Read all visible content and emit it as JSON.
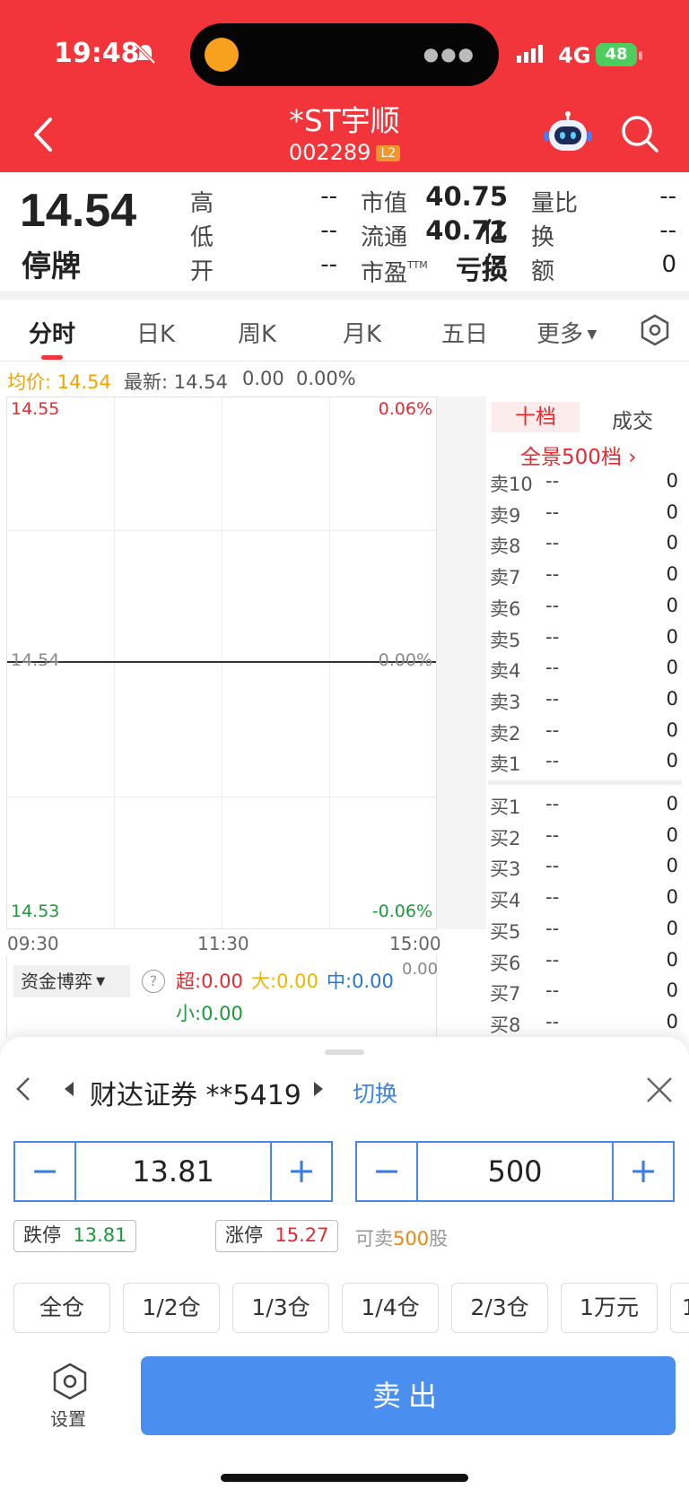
{
  "status": {
    "time": "19:48",
    "network": "4G",
    "battery": "48"
  },
  "header": {
    "title": "*ST宇顺",
    "code": "002289",
    "badge": "L2"
  },
  "quote": {
    "price": "14.54",
    "status": "停牌",
    "fields": [
      {
        "label": "高",
        "value": "--"
      },
      {
        "label": "低",
        "value": "--"
      },
      {
        "label": "开",
        "value": "--"
      },
      {
        "label": "市值",
        "value": "40.75亿"
      },
      {
        "label": "流通",
        "value": "40.71亿"
      },
      {
        "label": "市盈",
        "sup": "TTM",
        "value": "亏损"
      },
      {
        "label": "量比",
        "value": "--"
      },
      {
        "label": "换",
        "value": "--"
      },
      {
        "label": "额",
        "value": "0"
      }
    ]
  },
  "tabs": [
    "分时",
    "日K",
    "周K",
    "月K",
    "五日",
    "更多"
  ],
  "info_line": {
    "avg_label": "均价: 14.54",
    "latest": "最新: 14.54",
    "change": "0.00",
    "pct": "0.00%"
  },
  "chart": {
    "top_left": "14.55",
    "top_right": "0.06%",
    "mid_left": "14.54",
    "mid_right": "0.00%",
    "bottom_left": "14.53",
    "bottom_right": "-0.06%",
    "times": [
      "09:30",
      "11:30",
      "15:00"
    ]
  },
  "fund": {
    "label": "资金博弈",
    "value": "0.00",
    "super": "超:0.00",
    "big": "大:0.00",
    "mid": "中:0.00",
    "small": "小:0.00"
  },
  "orderbook": {
    "tab_active": "十档",
    "tab_other": "成交",
    "full_link": "全景500档 ›",
    "sells": [
      {
        "label": "卖10",
        "price": "--",
        "vol": "0"
      },
      {
        "label": "卖9",
        "price": "--",
        "vol": "0"
      },
      {
        "label": "卖8",
        "price": "--",
        "vol": "0"
      },
      {
        "label": "卖7",
        "price": "--",
        "vol": "0"
      },
      {
        "label": "卖6",
        "price": "--",
        "vol": "0"
      },
      {
        "label": "卖5",
        "price": "--",
        "vol": "0"
      },
      {
        "label": "卖4",
        "price": "--",
        "vol": "0"
      },
      {
        "label": "卖3",
        "price": "--",
        "vol": "0"
      },
      {
        "label": "卖2",
        "price": "--",
        "vol": "0"
      },
      {
        "label": "卖1",
        "price": "--",
        "vol": "0"
      }
    ],
    "buys": [
      {
        "label": "买1",
        "price": "--",
        "vol": "0"
      },
      {
        "label": "买2",
        "price": "--",
        "vol": "0"
      },
      {
        "label": "买3",
        "price": "--",
        "vol": "0"
      },
      {
        "label": "买4",
        "price": "--",
        "vol": "0"
      },
      {
        "label": "买5",
        "price": "--",
        "vol": "0"
      },
      {
        "label": "买6",
        "price": "--",
        "vol": "0"
      },
      {
        "label": "买7",
        "price": "--",
        "vol": "0"
      },
      {
        "label": "买8",
        "price": "--",
        "vol": "0"
      }
    ]
  },
  "trade": {
    "account": "财达证券 **5419",
    "switch": "切换",
    "price_value": "13.81",
    "qty_value": "500",
    "limit_down_label": "跌停",
    "limit_down_value": "13.81",
    "limit_up_label": "涨停",
    "limit_up_value": "15.27",
    "sellable_prefix": "可卖",
    "sellable_num": "500",
    "sellable_suffix": "股",
    "positions": [
      "全仓",
      "1/2仓",
      "1/3仓",
      "1/4仓",
      "2/3仓",
      "1万元",
      "1"
    ],
    "settings_label": "设置",
    "sell_label": "卖出"
  },
  "colors": {
    "header_red": "#f1353a",
    "accent_blue": "#4a8ff0",
    "up_red": "#e8292f",
    "down_green": "#1a9a3a"
  }
}
